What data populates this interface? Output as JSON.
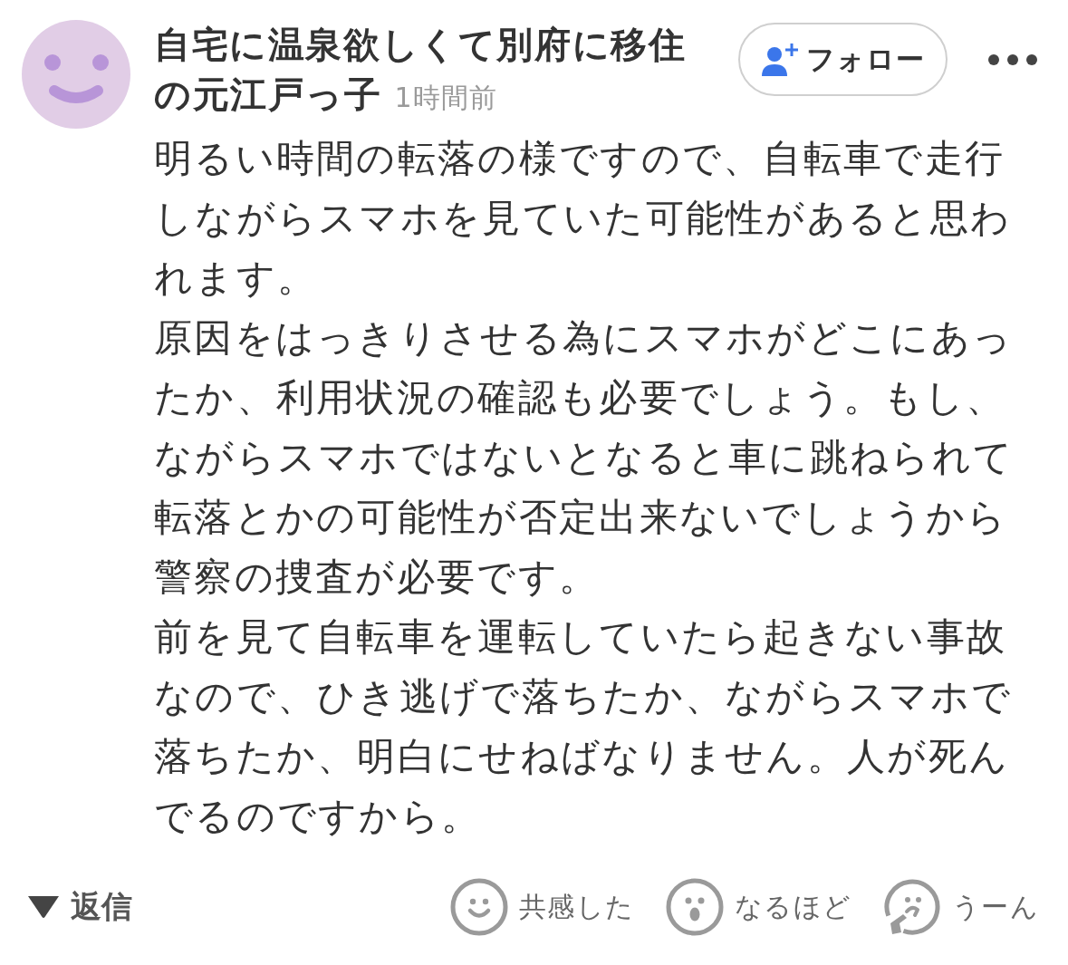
{
  "comment": {
    "author": {
      "name_lines": [
        "自宅に温泉欲しくて別府に移住",
        "の元江戸っ子"
      ],
      "time": "1時間前"
    },
    "follow_button": {
      "label": "フォロー"
    },
    "body": {
      "paragraphs": [
        "明るい時間の転落の様ですので、自転車で走行しながらスマホを見ていた可能性があると思われます。",
        "原因をはっきりさせる為にスマホがどこにあったか、利用状況の確認も必要でしょう。もし、ながらスマホではないとなると車に跳ねられて転落とかの可能性が否定出来ないでしょうから警察の捜査が必要です。",
        "前を見て自転車を運転していたら起きない事故なので、ひき逃げで落ちたか、ながらスマホで落ちたか、明白にせねばなりません。人が死んでるのですから。"
      ]
    },
    "footer": {
      "reply_toggle": {
        "label": "返信"
      },
      "reactions": [
        {
          "kind": "agree",
          "label": "共感した"
        },
        {
          "kind": "insight",
          "label": "なるほど"
        },
        {
          "kind": "doubt",
          "label": "うーん"
        }
      ]
    }
  }
}
